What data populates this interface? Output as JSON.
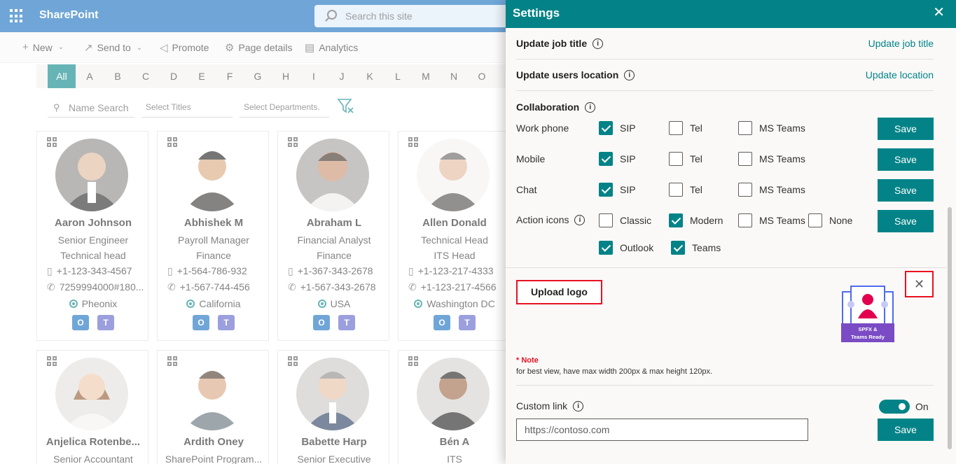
{
  "suite": {
    "brand": "SharePoint",
    "search_placeholder": "Search this site"
  },
  "commandbar": [
    {
      "label": "New",
      "icon": "plus-icon",
      "chevron": true
    },
    {
      "label": "Send to",
      "icon": "share-icon",
      "chevron": true
    },
    {
      "label": "Promote",
      "icon": "megaphone-icon",
      "chevron": false
    },
    {
      "label": "Page details",
      "icon": "gear-icon",
      "chevron": false
    },
    {
      "label": "Analytics",
      "icon": "chart-icon",
      "chevron": false
    }
  ],
  "alphabet": [
    "All",
    "A",
    "B",
    "C",
    "D",
    "E",
    "F",
    "G",
    "H",
    "I",
    "J",
    "K",
    "L",
    "M",
    "N",
    "O"
  ],
  "filters": {
    "name_placeholder": "Name Search",
    "titles_placeholder": "Select Titles",
    "departments_placeholder": "Select Departments."
  },
  "cards": [
    {
      "name": "Aaron Johnson",
      "title": "Senior Engineer",
      "dept": "Technical head",
      "mobile": "+1-123-343-4567",
      "work": "7259994000#180...",
      "location": "Pheonix"
    },
    {
      "name": "Abhishek M",
      "title": "Payroll Manager",
      "dept": "Finance",
      "mobile": "+1-564-786-932",
      "work": "+1-567-744-456",
      "location": "California"
    },
    {
      "name": "Abraham L",
      "title": "Financial Analyst",
      "dept": "Finance",
      "mobile": "+1-367-343-2678",
      "work": "+1-567-343-2678",
      "location": "USA"
    },
    {
      "name": "Allen Donald",
      "title": "Technical Head",
      "dept": "ITS Head",
      "mobile": "+1-123-217-4333",
      "work": "+1-123-217-4566",
      "location": "Washington DC"
    },
    {
      "name": "Anjelica Rotenbe...",
      "title": "Senior Accountant"
    },
    {
      "name": "Ardith Oney",
      "title": "SharePoint Program..."
    },
    {
      "name": "Babette Harp",
      "title": "Senior Executive"
    },
    {
      "name": "Bén A",
      "title": "ITS"
    }
  ],
  "colors": {
    "accent": "#038387",
    "suite": "#0f6cbd",
    "highlight": "#e81123"
  },
  "panel": {
    "title": "Settings",
    "job_title": {
      "label": "Update job title",
      "link": "Update job title"
    },
    "location": {
      "label": "Update users location",
      "link": "Update location"
    },
    "collaboration": {
      "heading": "Collaboration",
      "rows": [
        {
          "label": "Work phone",
          "options": [
            {
              "label": "SIP",
              "checked": true
            },
            {
              "label": "Tel",
              "checked": false
            },
            {
              "label": "MS Teams",
              "checked": false
            }
          ],
          "save": "Save"
        },
        {
          "label": "Mobile",
          "options": [
            {
              "label": "SIP",
              "checked": true
            },
            {
              "label": "Tel",
              "checked": false
            },
            {
              "label": "MS Teams",
              "checked": false
            }
          ],
          "save": "Save"
        },
        {
          "label": "Chat",
          "options": [
            {
              "label": "SIP",
              "checked": true
            },
            {
              "label": "Tel",
              "checked": false
            },
            {
              "label": "MS Teams",
              "checked": false
            }
          ],
          "save": "Save"
        }
      ],
      "action_icons": {
        "label": "Action icons",
        "options": [
          {
            "label": "Classic",
            "checked": false
          },
          {
            "label": "Modern",
            "checked": true
          },
          {
            "label": "MS Teams",
            "checked": false
          },
          {
            "label": "None",
            "checked": false
          },
          {
            "label": "Outlook",
            "checked": true
          },
          {
            "label": "Teams",
            "checked": true
          }
        ],
        "save": "Save"
      }
    },
    "upload": {
      "button": "Upload logo",
      "logo_line1": "SPFX &",
      "logo_line2": "Teams Ready"
    },
    "note": {
      "star": "* Note",
      "text": "for best view, have max width 200px & max height 120px."
    },
    "custom_link": {
      "label": "Custom link",
      "toggle_label": "On",
      "toggle_on": true,
      "placeholder": "https://contoso.com",
      "save": "Save"
    }
  }
}
